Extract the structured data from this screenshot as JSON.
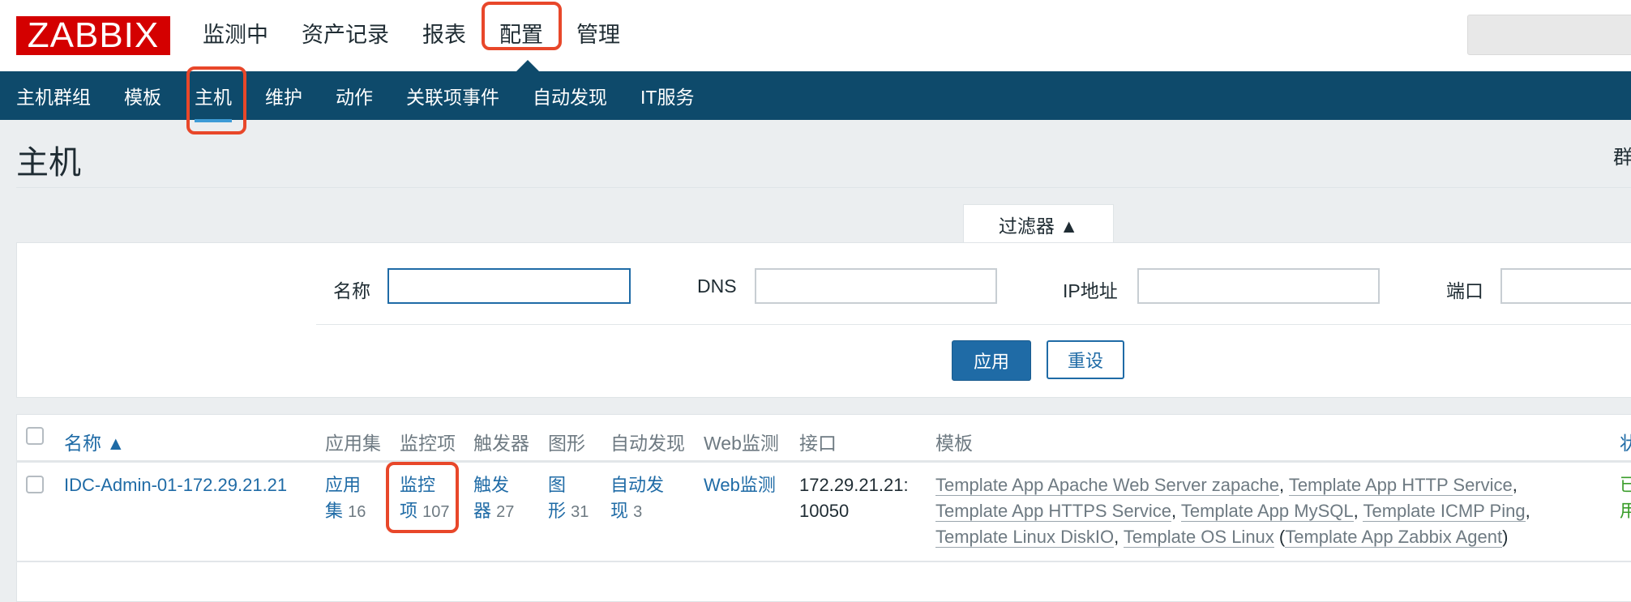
{
  "logo": "ZABBIX",
  "main_nav": [
    "监测中",
    "资产记录",
    "报表",
    "配置",
    "管理"
  ],
  "sub_nav": [
    "主机群组",
    "模板",
    "主机",
    "维护",
    "动作",
    "关联项事件",
    "自动发现",
    "IT服务"
  ],
  "page_title": "主机",
  "right_cut_text": "群",
  "filter": {
    "tab_label": "过滤器 ▲",
    "name_label": "名称",
    "dns_label": "DNS",
    "ip_label": "IP地址",
    "port_label": "端口",
    "name_value": "",
    "dns_value": "",
    "ip_value": "",
    "port_value": "",
    "apply": "应用",
    "reset": "重设"
  },
  "table": {
    "headers": [
      "名称 ▲",
      "应用集",
      "监控项",
      "触发器",
      "图形",
      "自动发现",
      "Web监测",
      "接口",
      "模板",
      "状"
    ],
    "row": {
      "name": "IDC-Admin-01-172.29.21.21",
      "apps_l1": "应用",
      "apps_l2": "集",
      "apps_count": "16",
      "items_l1": "监控",
      "items_l2": "项",
      "items_count": "107",
      "triggers_l1": "触发",
      "triggers_l2": "器",
      "triggers_count": "27",
      "graphs_l1": "图",
      "graphs_l2": "形",
      "graphs_count": "31",
      "discovery_l1": "自动发",
      "discovery_l2": "现",
      "discovery_count": "3",
      "web": "Web监测",
      "iface_l1": "172.29.21.21:",
      "iface_l2": "10050",
      "templates": [
        "Template App Apache Web Server zapache",
        "Template App HTTP Service",
        "Template App HTTPS Service",
        "Template App MySQL",
        "Template ICMP Ping",
        "Template Linux DiskIO",
        "Template OS Linux",
        "Template App Zabbix Agent"
      ],
      "status_l1": "已",
      "status_l2": "用"
    }
  }
}
